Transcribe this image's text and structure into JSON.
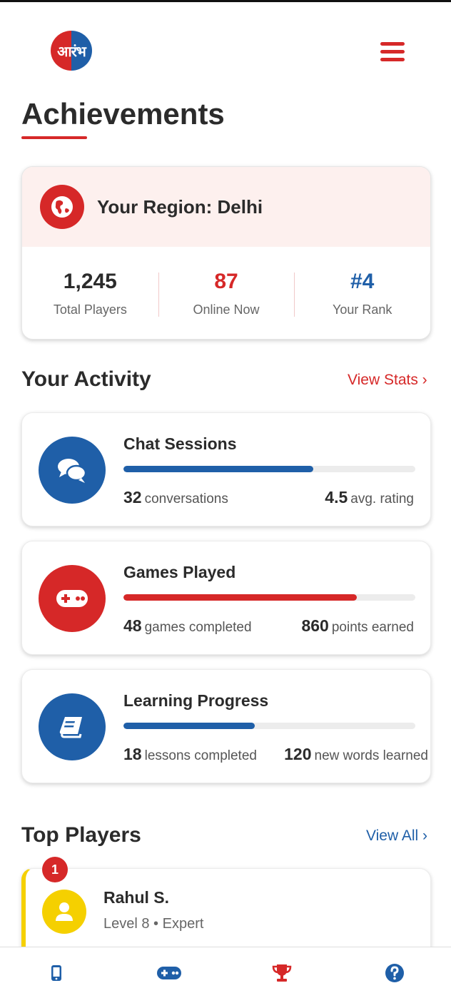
{
  "header": {
    "logo_text": "आरंभ",
    "page_title": "Achievements"
  },
  "region": {
    "title": "Your Region: Delhi",
    "stats": [
      {
        "value": "1,245",
        "label": "Total Players",
        "color": "#2b2b2b"
      },
      {
        "value": "87",
        "label": "Online Now",
        "color": "#d62828"
      },
      {
        "value": "#4",
        "label": "Your Rank",
        "color": "#1f5fa8"
      }
    ]
  },
  "activity": {
    "title": "Your Activity",
    "link": "View Stats ›",
    "cards": [
      {
        "title": "Chat Sessions",
        "progress": 0.65,
        "color": "#1f5fa8",
        "left_value": "32",
        "left_label": "conversations",
        "right_value": "4.5",
        "right_label": "avg. rating",
        "icon": "chat-icon"
      },
      {
        "title": "Games Played",
        "progress": 0.8,
        "color": "#d62828",
        "left_value": "48",
        "left_label": "games completed",
        "right_value": "860",
        "right_label": "points earned",
        "icon": "gamepad-icon"
      },
      {
        "title": "Learning Progress",
        "progress": 0.45,
        "color": "#1f5fa8",
        "left_value": "18",
        "left_label": "lessons completed",
        "right_value": "120",
        "right_label": "new words learned",
        "icon": "book-icon"
      }
    ]
  },
  "top_players": {
    "title": "Top Players",
    "link": "View All ›",
    "players": [
      {
        "rank": "1",
        "name": "Rahul S.",
        "level": "Level 8 • Expert"
      }
    ]
  },
  "nav": {
    "items": [
      {
        "icon": "phone-icon",
        "color": "#1f5fa8"
      },
      {
        "icon": "gamepad-icon",
        "color": "#1f5fa8"
      },
      {
        "icon": "trophy-icon",
        "color": "#d62828"
      },
      {
        "icon": "help-icon",
        "color": "#1f5fa8"
      }
    ]
  },
  "colors": {
    "accent_red": "#d62828",
    "accent_blue": "#1f5fa8",
    "gold": "#f5d000"
  }
}
